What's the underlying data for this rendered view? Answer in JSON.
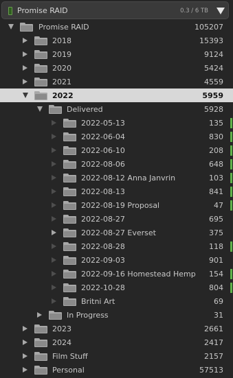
{
  "header": {
    "title": "Promise RAID",
    "capacity": "0.3 / 6 TB"
  },
  "rows": [
    {
      "label": "Promise RAID",
      "count": "105207",
      "level": 0,
      "arrow": "down",
      "synced": false,
      "selected": false
    },
    {
      "label": "2018",
      "count": "15393",
      "level": 1,
      "arrow": "right",
      "synced": false,
      "selected": false
    },
    {
      "label": "2019",
      "count": "9124",
      "level": 1,
      "arrow": "right",
      "synced": false,
      "selected": false
    },
    {
      "label": "2020",
      "count": "5424",
      "level": 1,
      "arrow": "right",
      "synced": false,
      "selected": false
    },
    {
      "label": "2021",
      "count": "4559",
      "level": 1,
      "arrow": "right",
      "synced": false,
      "selected": false
    },
    {
      "label": "2022",
      "count": "5959",
      "level": 1,
      "arrow": "down",
      "synced": false,
      "selected": true
    },
    {
      "label": "Delivered",
      "count": "5928",
      "level": 2,
      "arrow": "down",
      "synced": false,
      "selected": false
    },
    {
      "label": "2022-05-13",
      "count": "135",
      "level": 3,
      "arrow": "dim",
      "synced": true,
      "selected": false
    },
    {
      "label": "2022-06-04",
      "count": "830",
      "level": 3,
      "arrow": "dim",
      "synced": true,
      "selected": false
    },
    {
      "label": "2022-06-10",
      "count": "208",
      "level": 3,
      "arrow": "dim",
      "synced": true,
      "selected": false
    },
    {
      "label": "2022-08-06",
      "count": "648",
      "level": 3,
      "arrow": "dim",
      "synced": true,
      "selected": false
    },
    {
      "label": "2022-08-12 Anna Janvrin",
      "count": "103",
      "level": 3,
      "arrow": "dim",
      "synced": true,
      "selected": false
    },
    {
      "label": "2022-08-13",
      "count": "841",
      "level": 3,
      "arrow": "dim",
      "synced": true,
      "selected": false
    },
    {
      "label": "2022-08-19 Proposal",
      "count": "47",
      "level": 3,
      "arrow": "dim",
      "synced": true,
      "selected": false
    },
    {
      "label": "2022-08-27",
      "count": "695",
      "level": 3,
      "arrow": "dim",
      "synced": false,
      "selected": false
    },
    {
      "label": "2022-08-27 Everset",
      "count": "375",
      "level": 3,
      "arrow": "right",
      "synced": false,
      "selected": false
    },
    {
      "label": "2022-08-28",
      "count": "118",
      "level": 3,
      "arrow": "dim",
      "synced": true,
      "selected": false
    },
    {
      "label": "2022-09-03",
      "count": "901",
      "level": 3,
      "arrow": "dim",
      "synced": false,
      "selected": false
    },
    {
      "label": "2022-09-16 Homestead Hemp",
      "count": "154",
      "level": 3,
      "arrow": "dim",
      "synced": true,
      "selected": false
    },
    {
      "label": "2022-10-28",
      "count": "804",
      "level": 3,
      "arrow": "dim",
      "synced": true,
      "selected": false
    },
    {
      "label": "Britni Art",
      "count": "69",
      "level": 3,
      "arrow": "dim",
      "synced": false,
      "selected": false
    },
    {
      "label": "In Progress",
      "count": "31",
      "level": 2,
      "arrow": "right",
      "synced": false,
      "selected": false
    },
    {
      "label": "2023",
      "count": "2661",
      "level": 1,
      "arrow": "right",
      "synced": false,
      "selected": false
    },
    {
      "label": "2024",
      "count": "2417",
      "level": 1,
      "arrow": "right",
      "synced": false,
      "selected": false
    },
    {
      "label": "Film Stuff",
      "count": "2157",
      "level": 1,
      "arrow": "right",
      "synced": false,
      "selected": false
    },
    {
      "label": "Personal",
      "count": "57513",
      "level": 1,
      "arrow": "right",
      "synced": false,
      "selected": false
    }
  ]
}
